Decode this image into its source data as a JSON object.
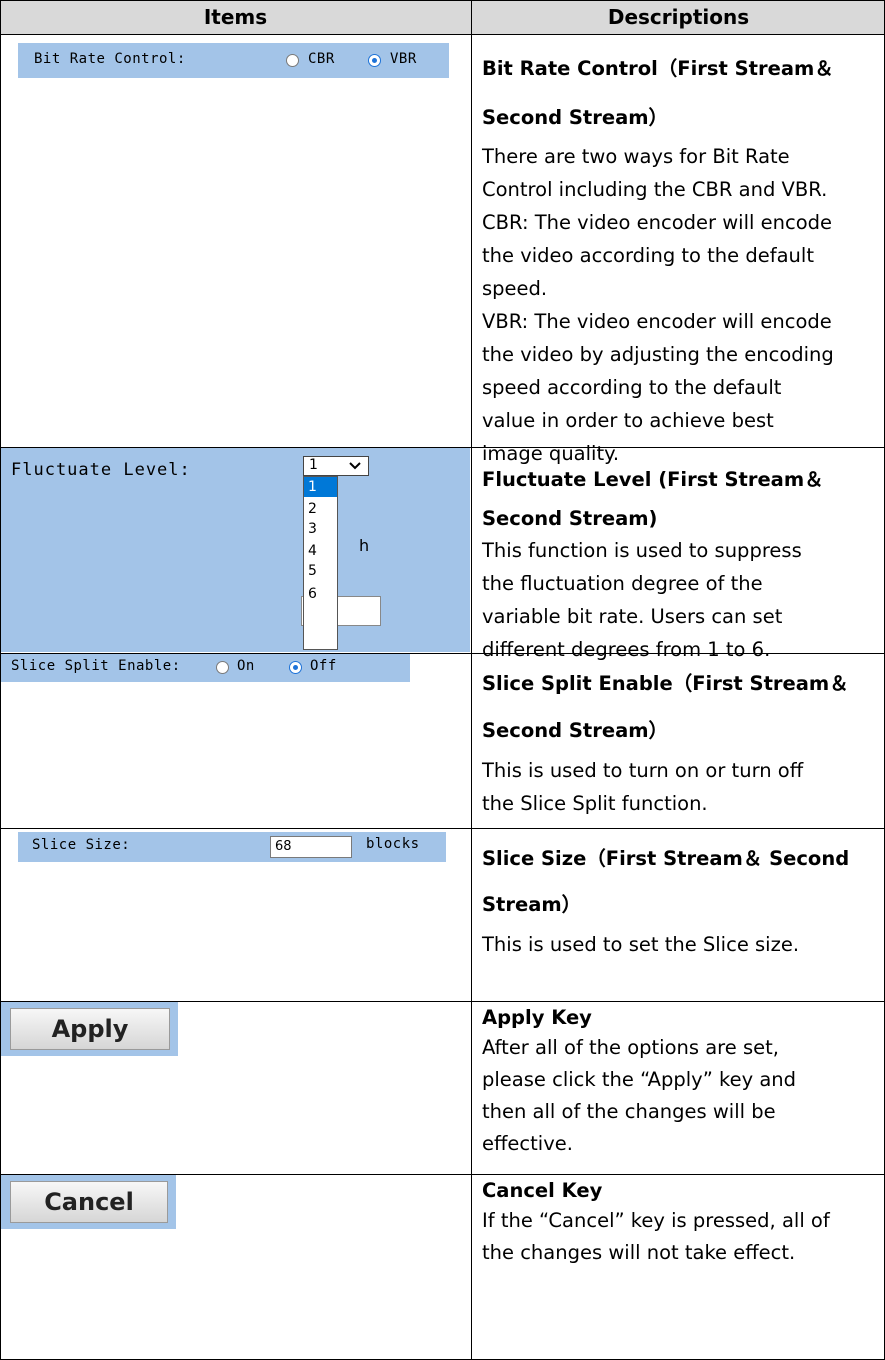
{
  "table": {
    "headers": {
      "items": "Items",
      "descriptions": "Descriptions"
    }
  },
  "bit_rate": {
    "label": "Bit Rate Control:",
    "options": [
      "CBR",
      "VBR"
    ],
    "selected": "VBR",
    "title": "Bit Rate Control（First Stream＆",
    "title2": "Second Stream）",
    "desc1": "There are two ways for Bit Rate",
    "desc2": "Control including the CBR and VBR.",
    "desc3": "CBR: The video encoder will encode",
    "desc4": "the video according to the default",
    "desc5": "speed.",
    "desc6": "VBR: The video encoder will encode",
    "desc7": "the video by adjusting the encoding",
    "desc8": "speed according to the default",
    "desc9": "value in order to achieve best",
    "desc10": "image quality."
  },
  "fluctuate": {
    "label": "Fluctuate Level:",
    "selected_value": "1",
    "options": [
      "1",
      "2",
      "3",
      "4",
      "5",
      "6"
    ],
    "title": "Fluctuate Level (First Stream＆",
    "title2": "Second Stream)",
    "desc1": "This function is used to suppress",
    "desc2": "the fluctuation degree of the",
    "desc3": "variable bit rate. Users can set",
    "desc4": "different degrees from 1 to 6."
  },
  "slice_split": {
    "label": "Slice Split Enable:",
    "options": [
      "On",
      "Off"
    ],
    "selected": "Off",
    "title": "Slice Split Enable（First Stream＆",
    "title2": "Second Stream）",
    "desc1": "This is used to turn on or turn off",
    "desc2": "the Slice Split function."
  },
  "slice_size": {
    "label": "Slice Size:",
    "value": "68",
    "unit": "blocks",
    "title": "Slice Size（First Stream＆ Second",
    "title2": "Stream）",
    "desc1": "This is used to set the Slice size."
  },
  "apply": {
    "button": "Apply",
    "title": "Apply Key",
    "desc1": "After all of the options are set,",
    "desc2": "please click the “Apply” key and",
    "desc3": "then all of the changes will be",
    "desc4": "effective."
  },
  "cancel": {
    "button": "Cancel",
    "title": "Cancel Key",
    "desc1": "If the “Cancel” key is pressed, all of",
    "desc2": "the changes will not take effect."
  },
  "colors": {
    "panel": "#a3c4e8",
    "header": "#d9d9d9",
    "radio_selected": "#1e73d8",
    "list_highlight": "#0078d7"
  }
}
